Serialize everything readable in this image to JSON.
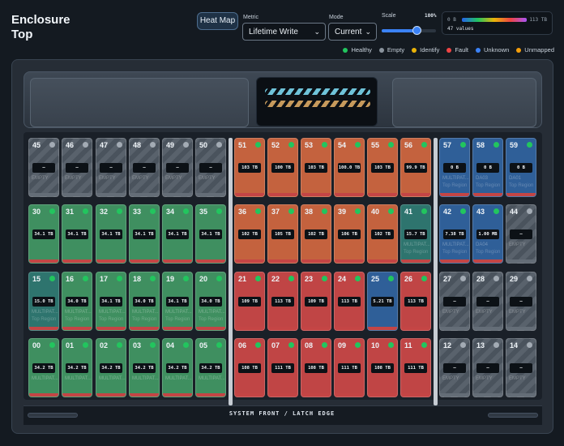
{
  "header": {
    "title_line1": "Enclosure",
    "title_line2": "Top",
    "heatmap_button": "Heat Map",
    "metric_label": "Metric",
    "metric_value": "Lifetime Write",
    "mode_label": "Mode",
    "mode_value": "Current",
    "scale_label": "Scale",
    "scale_value": "100%",
    "scale_percent": 100
  },
  "value_legend": {
    "min": "0 B",
    "max": "113 TB",
    "count": "47 values"
  },
  "status_legend": [
    {
      "label": "Healthy",
      "color": "#22c55e"
    },
    {
      "label": "Empty",
      "color": "#8a939d"
    },
    {
      "label": "Identify",
      "color": "#eab308"
    },
    {
      "label": "Fault",
      "color": "#ef4444"
    },
    {
      "label": "Unknown",
      "color": "#3b82f6"
    },
    {
      "label": "Unmapped",
      "color": "#f59e0b"
    }
  ],
  "colors": {
    "green": "#3f8f60",
    "orange": "#c4623e",
    "red": "#c04545",
    "blue": "#2f5f98",
    "teal": "#2e746e",
    "empty": "#59626c"
  },
  "rows": [
    [
      {
        "n": "45",
        "v": "—",
        "c": "empty",
        "m": "EMPTY",
        "l": ""
      },
      {
        "n": "46",
        "v": "—",
        "c": "empty",
        "m": "EMPTY",
        "l": ""
      },
      {
        "n": "47",
        "v": "—",
        "c": "empty",
        "m": "EMPTY",
        "l": ""
      },
      {
        "n": "48",
        "v": "—",
        "c": "empty",
        "m": "EMPTY",
        "l": ""
      },
      {
        "n": "49",
        "v": "—",
        "c": "empty",
        "m": "EMPTY",
        "l": ""
      },
      {
        "n": "50",
        "v": "—",
        "c": "empty",
        "m": "EMPTY",
        "l": ""
      },
      {
        "n": "51",
        "v": "103 TB",
        "c": "orange",
        "m": "",
        "l": ""
      },
      {
        "n": "52",
        "v": "100 TB",
        "c": "orange",
        "m": "",
        "l": ""
      },
      {
        "n": "53",
        "v": "103 TB",
        "c": "orange",
        "m": "",
        "l": ""
      },
      {
        "n": "54",
        "v": "100.0 TB",
        "c": "orange",
        "m": "",
        "l": ""
      },
      {
        "n": "55",
        "v": "103 TB",
        "c": "orange",
        "m": "",
        "l": ""
      },
      {
        "n": "56",
        "v": "99.9 TB",
        "c": "orange",
        "m": "",
        "l": ""
      },
      {
        "n": "57",
        "v": "0 B",
        "c": "blue",
        "m": "MULTIPAT...",
        "l": "Top Region"
      },
      {
        "n": "58",
        "v": "0 B",
        "c": "blue",
        "m": "DA03",
        "l": "Top Region"
      },
      {
        "n": "59",
        "v": "0 B",
        "c": "blue",
        "m": "DA01",
        "l": "Top Region"
      }
    ],
    [
      {
        "n": "30",
        "v": "34.1 TB",
        "c": "green",
        "m": "",
        "l": ""
      },
      {
        "n": "31",
        "v": "34.1 TB",
        "c": "green",
        "m": "",
        "l": ""
      },
      {
        "n": "32",
        "v": "34.1 TB",
        "c": "green",
        "m": "",
        "l": ""
      },
      {
        "n": "33",
        "v": "34.1 TB",
        "c": "green",
        "m": "",
        "l": ""
      },
      {
        "n": "34",
        "v": "34.1 TB",
        "c": "green",
        "m": "",
        "l": ""
      },
      {
        "n": "35",
        "v": "34.1 TB",
        "c": "green",
        "m": "",
        "l": ""
      },
      {
        "n": "36",
        "v": "102 TB",
        "c": "orange",
        "m": "",
        "l": ""
      },
      {
        "n": "37",
        "v": "105 TB",
        "c": "orange",
        "m": "",
        "l": ""
      },
      {
        "n": "38",
        "v": "102 TB",
        "c": "orange",
        "m": "",
        "l": ""
      },
      {
        "n": "39",
        "v": "106 TB",
        "c": "orange",
        "m": "",
        "l": ""
      },
      {
        "n": "40",
        "v": "102 TB",
        "c": "orange",
        "m": "",
        "l": ""
      },
      {
        "n": "41",
        "v": "15.7 TB",
        "c": "teal",
        "m": "MULTIPAT...",
        "l": "Top Region"
      },
      {
        "n": "42",
        "v": "7.38 TB",
        "c": "blue",
        "m": "MULTIPAT...",
        "l": "Top Region"
      },
      {
        "n": "43",
        "v": "1.00 MB",
        "c": "blue",
        "m": "DA04",
        "l": "Top Region"
      },
      {
        "n": "44",
        "v": "—",
        "c": "empty",
        "m": "EMPTY",
        "l": ""
      }
    ],
    [
      {
        "n": "15",
        "v": "15.0 TB",
        "c": "teal",
        "m": "MULTIPAT...",
        "l": "Top Region"
      },
      {
        "n": "16",
        "v": "34.0 TB",
        "c": "green",
        "m": "MULTIPAT...",
        "l": "Top Region"
      },
      {
        "n": "17",
        "v": "34.1 TB",
        "c": "green",
        "m": "MULTIPAT...",
        "l": "Top Region"
      },
      {
        "n": "18",
        "v": "34.0 TB",
        "c": "green",
        "m": "MULTIPAT...",
        "l": "Top Region"
      },
      {
        "n": "19",
        "v": "34.1 TB",
        "c": "green",
        "m": "MULTIPAT...",
        "l": "Top Region"
      },
      {
        "n": "20",
        "v": "34.0 TB",
        "c": "green",
        "m": "MULTIPAT...",
        "l": "Top Region"
      },
      {
        "n": "21",
        "v": "109 TB",
        "c": "red",
        "m": "",
        "l": ""
      },
      {
        "n": "22",
        "v": "113 TB",
        "c": "red",
        "m": "",
        "l": ""
      },
      {
        "n": "23",
        "v": "109 TB",
        "c": "red",
        "m": "",
        "l": ""
      },
      {
        "n": "24",
        "v": "113 TB",
        "c": "red",
        "m": "",
        "l": ""
      },
      {
        "n": "25",
        "v": "5.21 TB",
        "c": "blue",
        "m": "",
        "l": ""
      },
      {
        "n": "26",
        "v": "113 TB",
        "c": "red",
        "m": "",
        "l": ""
      },
      {
        "n": "27",
        "v": "—",
        "c": "empty",
        "m": "EMPTY",
        "l": ""
      },
      {
        "n": "28",
        "v": "—",
        "c": "empty",
        "m": "EMPTY",
        "l": ""
      },
      {
        "n": "29",
        "v": "—",
        "c": "empty",
        "m": "EMPTY",
        "l": ""
      }
    ],
    [
      {
        "n": "00",
        "v": "34.2 TB",
        "c": "green",
        "m": "MULTIPAT...",
        "l": ""
      },
      {
        "n": "01",
        "v": "34.2 TB",
        "c": "green",
        "m": "MULTIPAT...",
        "l": ""
      },
      {
        "n": "02",
        "v": "34.2 TB",
        "c": "green",
        "m": "MULTIPAT...",
        "l": ""
      },
      {
        "n": "03",
        "v": "34.2 TB",
        "c": "green",
        "m": "MULTIPAT...",
        "l": ""
      },
      {
        "n": "04",
        "v": "34.2 TB",
        "c": "green",
        "m": "MULTIPAT...",
        "l": ""
      },
      {
        "n": "05",
        "v": "34.2 TB",
        "c": "green",
        "m": "MULTIPAT...",
        "l": ""
      },
      {
        "n": "06",
        "v": "108 TB",
        "c": "red",
        "m": "",
        "l": ""
      },
      {
        "n": "07",
        "v": "111 TB",
        "c": "red",
        "m": "",
        "l": ""
      },
      {
        "n": "08",
        "v": "108 TB",
        "c": "red",
        "m": "",
        "l": ""
      },
      {
        "n": "09",
        "v": "111 TB",
        "c": "red",
        "m": "",
        "l": ""
      },
      {
        "n": "10",
        "v": "108 TB",
        "c": "red",
        "m": "",
        "l": ""
      },
      {
        "n": "11",
        "v": "111 TB",
        "c": "red",
        "m": "",
        "l": ""
      },
      {
        "n": "12",
        "v": "—",
        "c": "empty",
        "m": "EMPTY",
        "l": ""
      },
      {
        "n": "13",
        "v": "—",
        "c": "empty",
        "m": "EMPTY",
        "l": ""
      },
      {
        "n": "14",
        "v": "—",
        "c": "empty",
        "m": "EMPTY",
        "l": ""
      }
    ]
  ],
  "footer": {
    "label": "SYSTEM FRONT / LATCH EDGE"
  }
}
